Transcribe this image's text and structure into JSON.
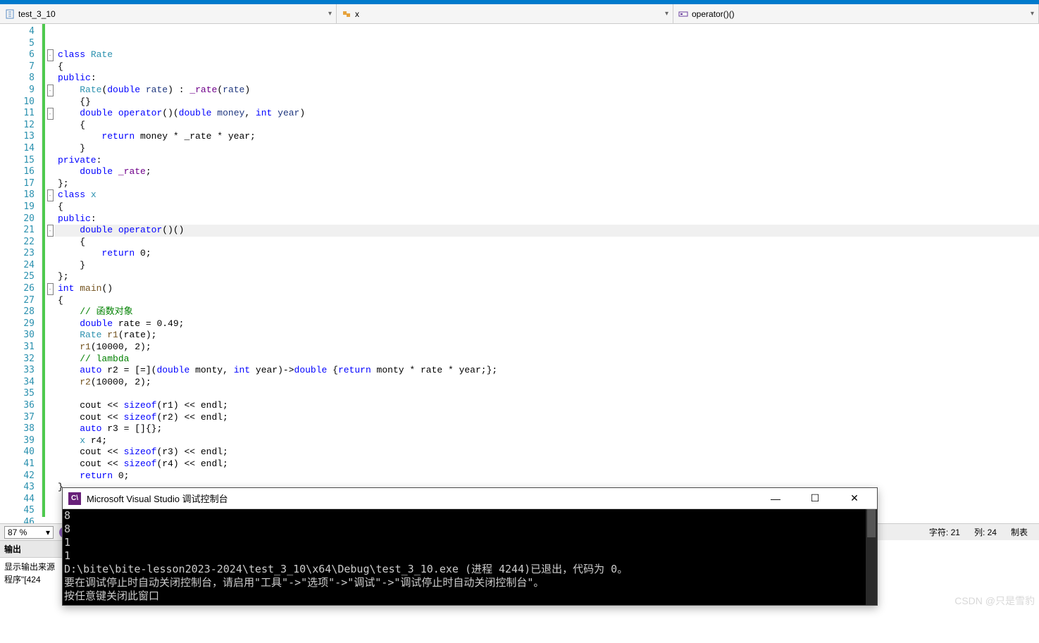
{
  "nav": {
    "scope": "test_3_10",
    "class": "x",
    "member": "operator()()"
  },
  "lines": {
    "start": 4,
    "end": 46
  },
  "code": {
    "l5": "",
    "l6_kw": "class",
    "l6_type": "Rate",
    "l7": "{",
    "l8_kw": "public",
    "l8_colon": ":",
    "l9_type": "Rate",
    "l9_p1": "(",
    "l9_kw": "double",
    "l9_var": "rate",
    "l9_p2": ") : ",
    "l9_field": "_rate",
    "l9_p3": "(",
    "l9_var2": "rate",
    "l9_p4": ")",
    "l10": "    {}",
    "l11_kw": "double",
    "l11_kw2": "operator",
    "l11_p1": "()(",
    "l11_kw3": "double",
    "l11_var": "money",
    "l11_c": ", ",
    "l11_kw4": "int",
    "l11_var2": "year",
    "l11_p2": ")",
    "l12": "    {",
    "l13_kw": "return",
    "l13_rest": " money * _rate * year;",
    "l14": "    }",
    "l15_kw": "private",
    "l15_colon": ":",
    "l16_kw": "double",
    "l16_field": "_rate",
    "l16_semi": ";",
    "l17": "};",
    "l18_kw": "class",
    "l18_type": "x",
    "l19": "{",
    "l20_kw": "public",
    "l20_colon": ":",
    "l21_kw": "double",
    "l21_kw2": "operator",
    "l21_rest": "()()",
    "l22": "    {",
    "l23_kw": "return",
    "l23_rest": " 0;",
    "l24": "    }",
    "l25": "};",
    "l26_kw": "int",
    "l26_fn": "main",
    "l26_rest": "()",
    "l27": "{",
    "l28_cmt": "// 函数对象",
    "l29_kw": "double",
    "l29_rest": " rate = 0.49;",
    "l30_type": "Rate",
    "l30_fn": "r1",
    "l30_rest": "(rate);",
    "l31_fn": "r1",
    "l31_rest": "(10000, 2);",
    "l32_cmt": "// lambda",
    "l33_kw": "auto",
    "l33_v": " r2 = [=](",
    "l33_kw2": "double",
    "l33_v2": " monty, ",
    "l33_kw3": "int",
    "l33_v3": " year)->",
    "l33_kw4": "double",
    "l33_v4": " {",
    "l33_kw5": "return",
    "l33_v5": " monty * rate * year;};",
    "l34_fn": "r2",
    "l34_rest": "(10000, 2);",
    "l35": "",
    "l36": "    cout << ",
    "l36_kw": "sizeof",
    "l36_rest": "(r1) << endl;",
    "l37": "    cout << ",
    "l37_kw": "sizeof",
    "l37_rest": "(r2) << endl;",
    "l38_kw": "auto",
    "l38_rest": " r3 = []{};",
    "l39_type": "x",
    "l39_rest": " r4;",
    "l40": "    cout << ",
    "l40_kw": "sizeof",
    "l40_rest": "(r3) << endl;",
    "l41": "    cout << ",
    "l41_kw": "sizeof",
    "l41_rest": "(r4) << endl;",
    "l42_kw": "return",
    "l42_rest": " 0;",
    "l43": "}"
  },
  "zoom": "87 %",
  "status": {
    "char_label": "字符:",
    "char": "21",
    "col_label": "列:",
    "col": "24",
    "tab": "制表"
  },
  "output": {
    "title": "输出",
    "line1": "显示输出来源",
    "line2": "程序\"[424"
  },
  "console": {
    "title": "Microsoft Visual Studio 调试控制台",
    "lines": [
      "8",
      "8",
      "1",
      "1",
      "",
      "D:\\bite\\bite-lesson2023-2024\\test_3_10\\x64\\Debug\\test_3_10.exe (进程 4244)已退出，代码为 0。",
      "要在调试停止时自动关闭控制台，请启用\"工具\"->\"选项\"->\"调试\"->\"调试停止时自动关闭控制台\"。",
      "按任意键关闭此窗口"
    ]
  },
  "watermark": "CSDN @只是雪豹"
}
